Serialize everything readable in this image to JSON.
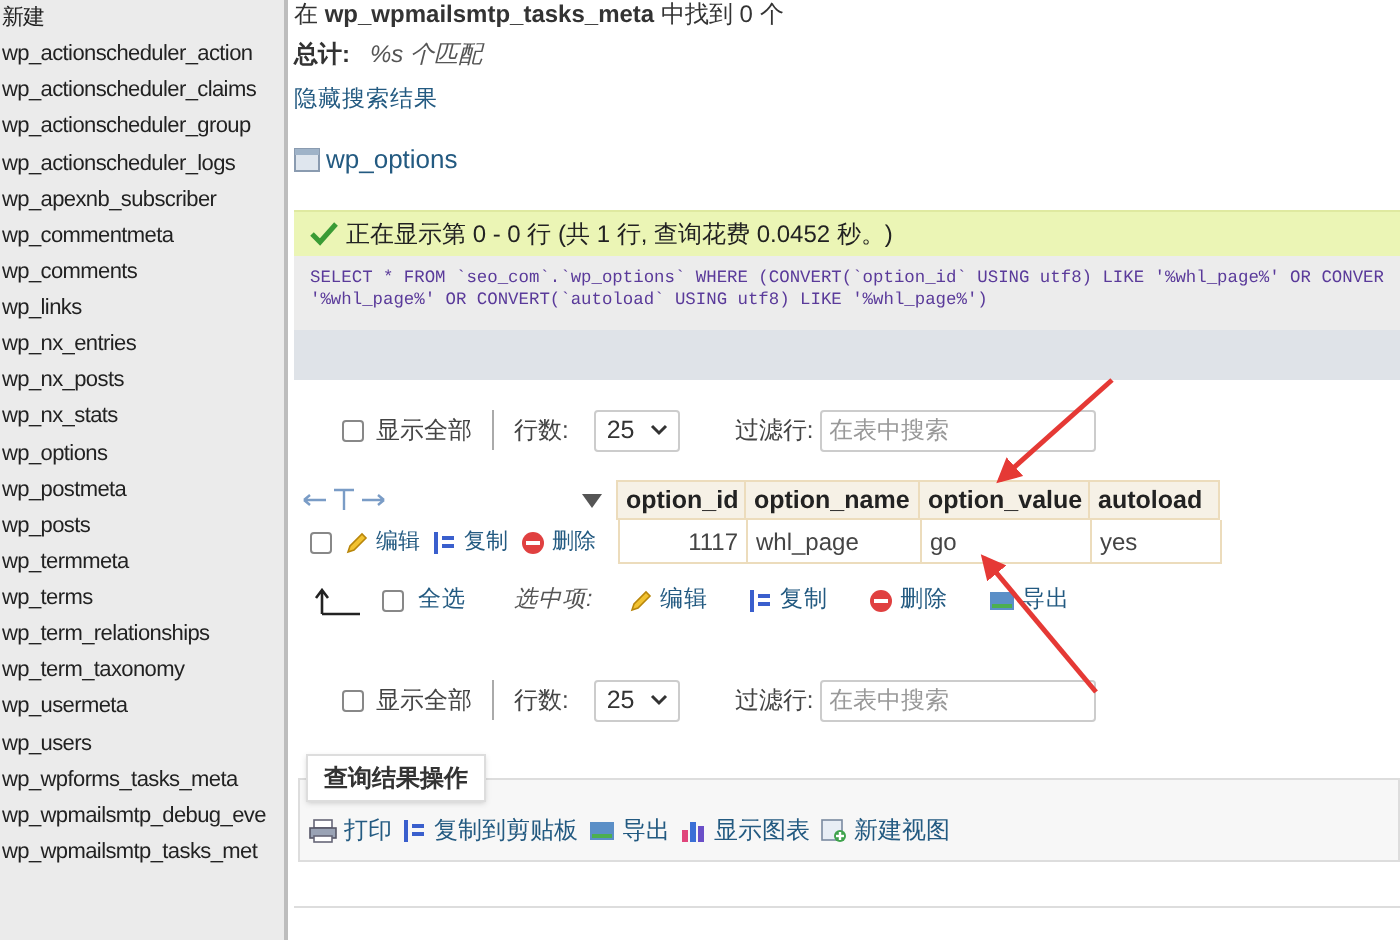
{
  "sidebar": {
    "items": [
      "新建",
      "wp_actionscheduler_action",
      "wp_actionscheduler_claims",
      "wp_actionscheduler_group",
      "wp_actionscheduler_logs",
      "wp_apexnb_subscriber",
      "wp_commentmeta",
      "wp_comments",
      "wp_links",
      "wp_nx_entries",
      "wp_nx_posts",
      "wp_nx_stats",
      "wp_options",
      "wp_postmeta",
      "wp_posts",
      "wp_termmeta",
      "wp_terms",
      "wp_term_relationships",
      "wp_term_taxonomy",
      "wp_usermeta",
      "wp_users",
      "wp_wpforms_tasks_meta",
      "wp_wpmailsmtp_debug_eve",
      "wp_wpmailsmtp_tasks_met"
    ]
  },
  "search_summary": "在 **wp_wpmailsmtp_tasks_meta** 中找到 0 个",
  "total": {
    "label": "总计:",
    "value": "%s 个匹配"
  },
  "hide_results_link": "隐藏搜索结果",
  "table_name": "wp_options",
  "success_message": "正在显示第 0 - 0 行 (共 1 行, 查询花费 0.0452 秒。)",
  "sql_lines": [
    "SELECT * FROM `seo_com`.`wp_options` WHERE (CONVERT(`option_id` USING utf8) LIKE '%whl_page%' OR CONVER",
    "'%whl_page%' OR CONVERT(`autoload` USING utf8) LIKE '%whl_page%')"
  ],
  "nav_top": {
    "show_all": "显示全部",
    "checked": false,
    "rows_label": "行数:",
    "rows_value": "25",
    "filter_label": "过滤行:",
    "filter_placeholder": "在表中搜索"
  },
  "results": {
    "columns": [
      "option_id",
      "option_name",
      "option_value",
      "autoload"
    ],
    "rows": [
      {
        "selected": false,
        "actions": [
          {
            "kind": "edit",
            "label": "编辑"
          },
          {
            "kind": "copy",
            "label": "复制"
          },
          {
            "kind": "delete",
            "label": "删除"
          }
        ],
        "cells": [
          "1117",
          "whl_page",
          "go",
          "yes"
        ]
      }
    ]
  },
  "bulk": {
    "select_all": "全选",
    "checked": false,
    "with_selected": "选中项:",
    "actions": [
      {
        "kind": "edit",
        "label": "编辑"
      },
      {
        "kind": "copy",
        "label": "复制"
      },
      {
        "kind": "delete",
        "label": "删除"
      },
      {
        "kind": "export",
        "label": "导出"
      }
    ]
  },
  "nav_bottom": {
    "show_all": "显示全部",
    "checked": false,
    "rows_label": "行数:",
    "rows_value": "25",
    "filter_label": "过滤行:",
    "filter_placeholder": "在表中搜索"
  },
  "operations": {
    "legend": "查询结果操作",
    "actions": [
      {
        "kind": "print",
        "label": "打印"
      },
      {
        "kind": "copy",
        "label": "复制到剪贴板"
      },
      {
        "kind": "export",
        "label": "导出"
      },
      {
        "kind": "chart",
        "label": "显示图表"
      },
      {
        "kind": "view",
        "label": "新建视图"
      }
    ]
  }
}
